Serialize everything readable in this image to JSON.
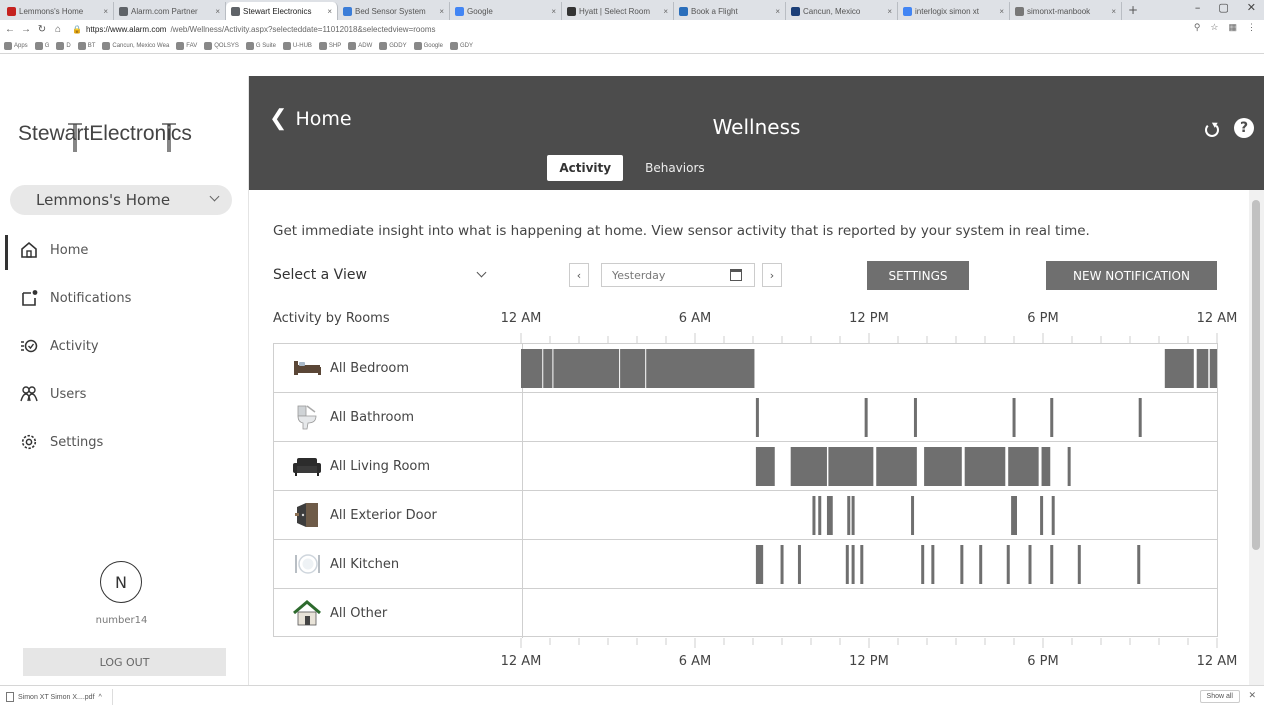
{
  "browser": {
    "tabs": [
      {
        "label": "Lemmons's Home",
        "color": "#c5221f",
        "active": false
      },
      {
        "label": "Alarm.com Partner",
        "color": "#5f6368",
        "active": false
      },
      {
        "label": "Stewart Electronics",
        "color": "#5f6368",
        "active": true
      },
      {
        "label": "Bed Sensor System",
        "color": "#3b7dd8",
        "active": false
      },
      {
        "label": "Google",
        "color": "#4285f4",
        "active": false
      },
      {
        "label": "Hyatt | Select Room",
        "color": "#333333",
        "active": false
      },
      {
        "label": "Book a Flight",
        "color": "#2a6ebb",
        "active": false
      },
      {
        "label": "Cancun, Mexico",
        "color": "#1c3f78",
        "active": false
      },
      {
        "label": "interlogix simon xt",
        "color": "#4285f4",
        "active": false
      },
      {
        "label": "simonxt-manbook",
        "color": "#777777",
        "active": false
      }
    ],
    "url_host": "https://www.alarm.com",
    "url_path": "/web/Wellness/Activity.aspx?selecteddate=11012018&selectedview=rooms",
    "bookmarks": [
      "Apps",
      "G",
      "D",
      "BT",
      "Cancun, Mexico Wea",
      "FAV",
      "QOLSYS",
      "G Suite",
      "U-HUB",
      "SHP",
      "ADW",
      "GDDY",
      "Google",
      "GDY"
    ]
  },
  "sidebar": {
    "brand": "StewartElectronics",
    "home_select": "Lemmons's Home",
    "nav": [
      {
        "label": "Home",
        "icon": "home-icon",
        "active": true
      },
      {
        "label": "Notifications",
        "icon": "notifications-icon",
        "active": false
      },
      {
        "label": "Activity",
        "icon": "activity-icon",
        "active": false
      },
      {
        "label": "Users",
        "icon": "users-icon",
        "active": false
      },
      {
        "label": "Settings",
        "icon": "settings-icon",
        "active": false
      }
    ],
    "avatar_initial": "N",
    "username": "number14",
    "logout": "LOG OUT"
  },
  "header": {
    "back_label": "Home",
    "title": "Wellness",
    "tabs": [
      {
        "label": "Activity",
        "active": true
      },
      {
        "label": "Behaviors",
        "active": false
      }
    ]
  },
  "main": {
    "intro": "Get immediate insight into what is happening at home. View sensor activity that is reported by your system in real time.",
    "view_select": "Select a View",
    "date_value": "Yesterday",
    "settings_label": "SETTINGS",
    "notification_label": "NEW NOTIFICATION",
    "chart_title": "Activity by Rooms",
    "time_ticks": [
      "12 AM",
      "6 AM",
      "12 PM",
      "6 PM",
      "12 AM"
    ]
  },
  "chart_data": {
    "type": "timeline",
    "title": "Activity by Rooms",
    "x_unit": "hour of day",
    "xlim": [
      0,
      24
    ],
    "x_tick_labels": [
      "12 AM",
      "6 AM",
      "12 PM",
      "6 PM",
      "12 AM"
    ],
    "colors": {
      "activity": "#6f6f6f",
      "bar_divider": "#ffffff",
      "grid": "#cfcfcf"
    },
    "rooms": [
      {
        "name": "All Bedroom",
        "icon": "bed-icon",
        "events": [
          [
            0,
            8.05
          ],
          [
            22.2,
            23.2
          ],
          [
            23.3,
            23.7
          ],
          [
            23.75,
            24
          ]
        ]
      },
      {
        "name": "All Bathroom",
        "icon": "toilet-icon",
        "events": [
          [
            8.1,
            8.15
          ],
          [
            11.85,
            11.9
          ],
          [
            13.55,
            13.6
          ],
          [
            16.95,
            17.0
          ],
          [
            18.25,
            18.3
          ],
          [
            21.3,
            21.35
          ]
        ]
      },
      {
        "name": "All Living Room",
        "icon": "sofa-icon",
        "events": [
          [
            8.1,
            8.75
          ],
          [
            9.3,
            10.55
          ],
          [
            10.6,
            12.15
          ],
          [
            12.25,
            13.65
          ],
          [
            13.9,
            15.2
          ],
          [
            15.3,
            16.7
          ],
          [
            16.8,
            17.85
          ],
          [
            17.95,
            18.25
          ],
          [
            18.85,
            18.9
          ]
        ]
      },
      {
        "name": "All Exterior Door",
        "icon": "door-icon",
        "events": [
          [
            10.05,
            10.1
          ],
          [
            10.25,
            10.3
          ],
          [
            10.55,
            10.75
          ],
          [
            11.25,
            11.3
          ],
          [
            11.4,
            11.45
          ],
          [
            13.45,
            13.5
          ],
          [
            16.9,
            16.95
          ],
          [
            17.0,
            17.05
          ],
          [
            17.9,
            17.95
          ],
          [
            18.3,
            18.35
          ]
        ]
      },
      {
        "name": "All Kitchen",
        "icon": "kitchen-icon",
        "events": [
          [
            8.1,
            8.35
          ],
          [
            8.95,
            9.05
          ],
          [
            9.55,
            9.6
          ],
          [
            11.2,
            11.3
          ],
          [
            11.4,
            11.45
          ],
          [
            11.7,
            11.75
          ],
          [
            13.8,
            13.85
          ],
          [
            14.15,
            14.2
          ],
          [
            15.15,
            15.2
          ],
          [
            15.8,
            15.85
          ],
          [
            16.75,
            16.8
          ],
          [
            17.5,
            17.55
          ],
          [
            18.25,
            18.3
          ],
          [
            19.2,
            19.25
          ],
          [
            21.25,
            21.3
          ]
        ]
      },
      {
        "name": "All Other",
        "icon": "house-icon",
        "events": []
      }
    ]
  },
  "download": {
    "file": "Simon XT Simon X....pdf",
    "show_all": "Show all"
  }
}
